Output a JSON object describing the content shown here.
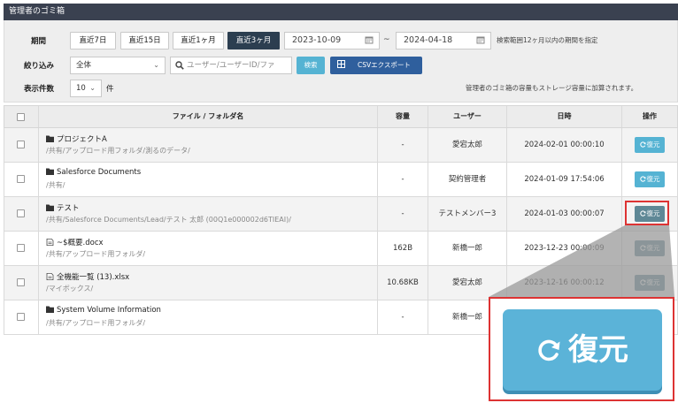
{
  "window": {
    "title": "管理者のゴミ箱"
  },
  "filters": {
    "period_label": "期間",
    "period_buttons": [
      "直近7日",
      "直近15日",
      "直近1ヶ月",
      "直近3ヶ月"
    ],
    "active_period": "直近3ヶ月",
    "date_from": "2023-10-09",
    "date_separator": "~",
    "date_to": "2024-04-18",
    "date_note": "検索範囲12ヶ月以内の期間を指定",
    "narrow_label": "絞り込み",
    "scope_value": "全体",
    "search_placeholder": "ユーザー/ユーザーID/ファ",
    "search_button": "検索",
    "csv_button": "CSVエクスポート",
    "count_label": "表示件数",
    "count_value": "10",
    "count_unit": "件",
    "capacity_note": "管理者のゴミ箱の容量もストレージ容量に加算されます。"
  },
  "table": {
    "headers": {
      "name": "ファイル / フォルダ名",
      "size": "容量",
      "user": "ユーザー",
      "date": "日時",
      "action": "操作"
    },
    "rows": [
      {
        "type": "folder",
        "name": "プロジェクトA",
        "path": "/共有/アップロード用フォルダ/測るのデータ/",
        "size": "-",
        "user": "愛宕太郎",
        "date": "2024-02-01 00:00:10",
        "action": "復元"
      },
      {
        "type": "folder",
        "name": "Salesforce Documents",
        "path": "/共有/",
        "size": "-",
        "user": "契約管理者",
        "date": "2024-01-09 17:54:06",
        "action": "復元"
      },
      {
        "type": "folder",
        "name": "テスト",
        "path": "/共有/Salesforce Documents/Lead/テスト 太郎 (00Q1e000002d6TIEAI)/",
        "size": "-",
        "user": "テストメンバー3",
        "date": "2024-01-03 00:00:07",
        "action": "復元"
      },
      {
        "type": "file",
        "name": "~$概要.docx",
        "path": "/共有/アップロード用フォルダ/",
        "size": "162B",
        "user": "新橋一郎",
        "date": "2023-12-23 00:00:09",
        "action": "復元"
      },
      {
        "type": "file",
        "name": "全機能一覧 (13).xlsx",
        "path": "/マイボックス/",
        "size": "10.68KB",
        "user": "愛宕太郎",
        "date": "2023-12-16 00:00:12",
        "action": "復元"
      },
      {
        "type": "folder",
        "name": "System Volume Information",
        "path": "/共有/アップロード用フォルダ/",
        "size": "-",
        "user": "新橋一郎",
        "date": "",
        "action": ""
      }
    ]
  },
  "callout": {
    "label": "復元"
  },
  "colors": {
    "titlebar": "#3a4150",
    "active_button": "#2c3e50",
    "restore_button": "#55b3d3",
    "csv_button": "#2f5f9d",
    "highlight": "#dd3333"
  },
  "icons": {
    "calendar": "calendar-icon",
    "search": "search-icon",
    "grid": "grid-icon",
    "folder": "folder-icon",
    "file": "file-icon",
    "restore": "refresh-icon"
  }
}
